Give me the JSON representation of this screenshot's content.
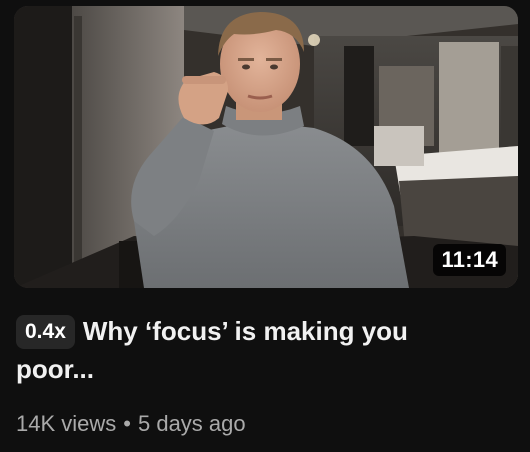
{
  "video": {
    "duration": "11:14",
    "playback_speed": "0.4x",
    "title_line1": "Why ‘focus’ is making you",
    "title_line2": "poor...",
    "views": "14K views",
    "separator": "•",
    "age": "5 days ago"
  },
  "colors": {
    "background": "#0f0f0f",
    "title": "#f1f1f1",
    "meta": "#aaaaaa",
    "badge_bg": "#272727"
  }
}
